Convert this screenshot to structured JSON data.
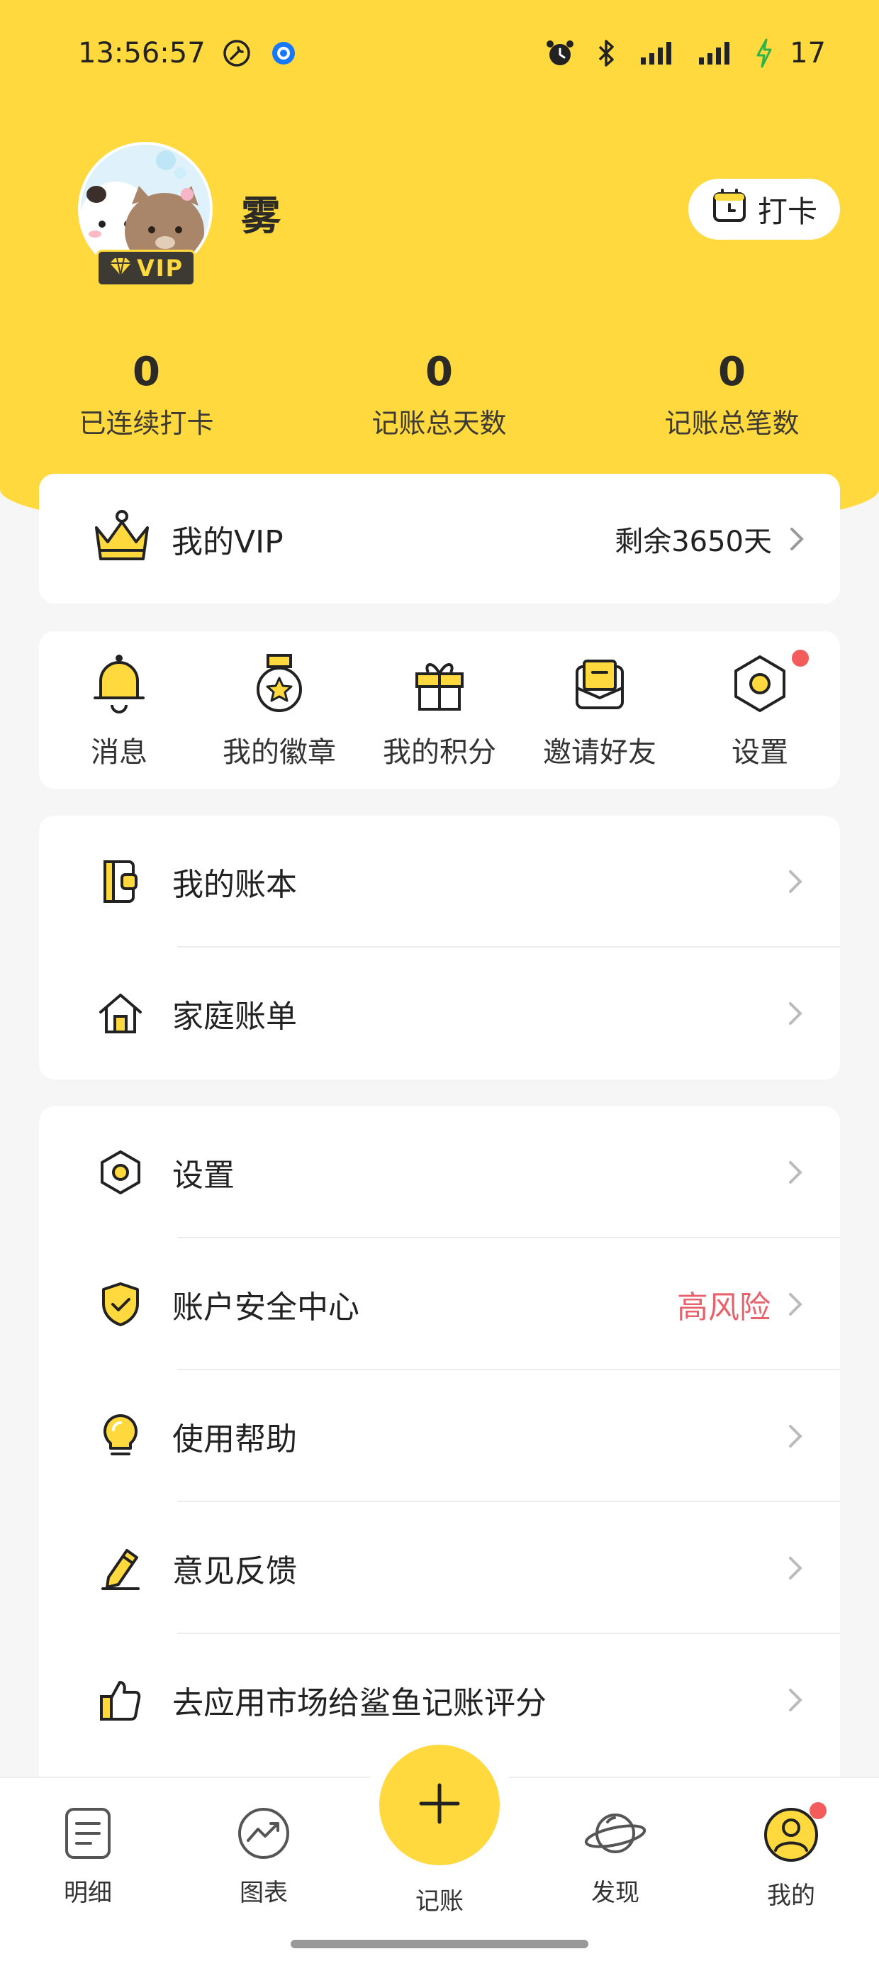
{
  "status_bar": {
    "time": "13:56:57",
    "battery": "17"
  },
  "profile": {
    "username": "雾",
    "vip_badge": "VIP",
    "checkin_label": "打卡"
  },
  "stats": [
    {
      "value": "0",
      "label": "已连续打卡"
    },
    {
      "value": "0",
      "label": "记账总天数"
    },
    {
      "value": "0",
      "label": "记账总笔数"
    }
  ],
  "vip_card": {
    "title": "我的VIP",
    "remaining": "剩余3650天"
  },
  "quick_actions": [
    {
      "label": "消息",
      "icon": "bell-icon"
    },
    {
      "label": "我的徽章",
      "icon": "medal-icon"
    },
    {
      "label": "我的积分",
      "icon": "gift-icon"
    },
    {
      "label": "邀请好友",
      "icon": "envelope-icon"
    },
    {
      "label": "设置",
      "icon": "hexagon-settings-icon",
      "has_dot": true
    }
  ],
  "menu_group_1": [
    {
      "label": "我的账本",
      "icon": "wallet-book-icon"
    },
    {
      "label": "家庭账单",
      "icon": "house-icon"
    }
  ],
  "menu_group_2": [
    {
      "label": "设置",
      "icon": "hexagon-settings-icon"
    },
    {
      "label": "账户安全中心",
      "icon": "shield-check-icon",
      "extra": "高风险"
    },
    {
      "label": "使用帮助",
      "icon": "lightbulb-icon"
    },
    {
      "label": "意见反馈",
      "icon": "pencil-icon"
    },
    {
      "label": "去应用市场给鲨鱼记账评分",
      "icon": "thumbs-up-icon"
    }
  ],
  "bottom_nav": [
    {
      "label": "明细",
      "icon": "list-icon"
    },
    {
      "label": "图表",
      "icon": "chart-icon"
    },
    {
      "label": "记账",
      "icon": "plus-icon"
    },
    {
      "label": "发现",
      "icon": "planet-icon"
    },
    {
      "label": "我的",
      "icon": "person-icon",
      "active": true
    }
  ],
  "colors": {
    "accent": "#ffd93d",
    "danger": "#e8626c",
    "dot": "#f45b5b"
  }
}
